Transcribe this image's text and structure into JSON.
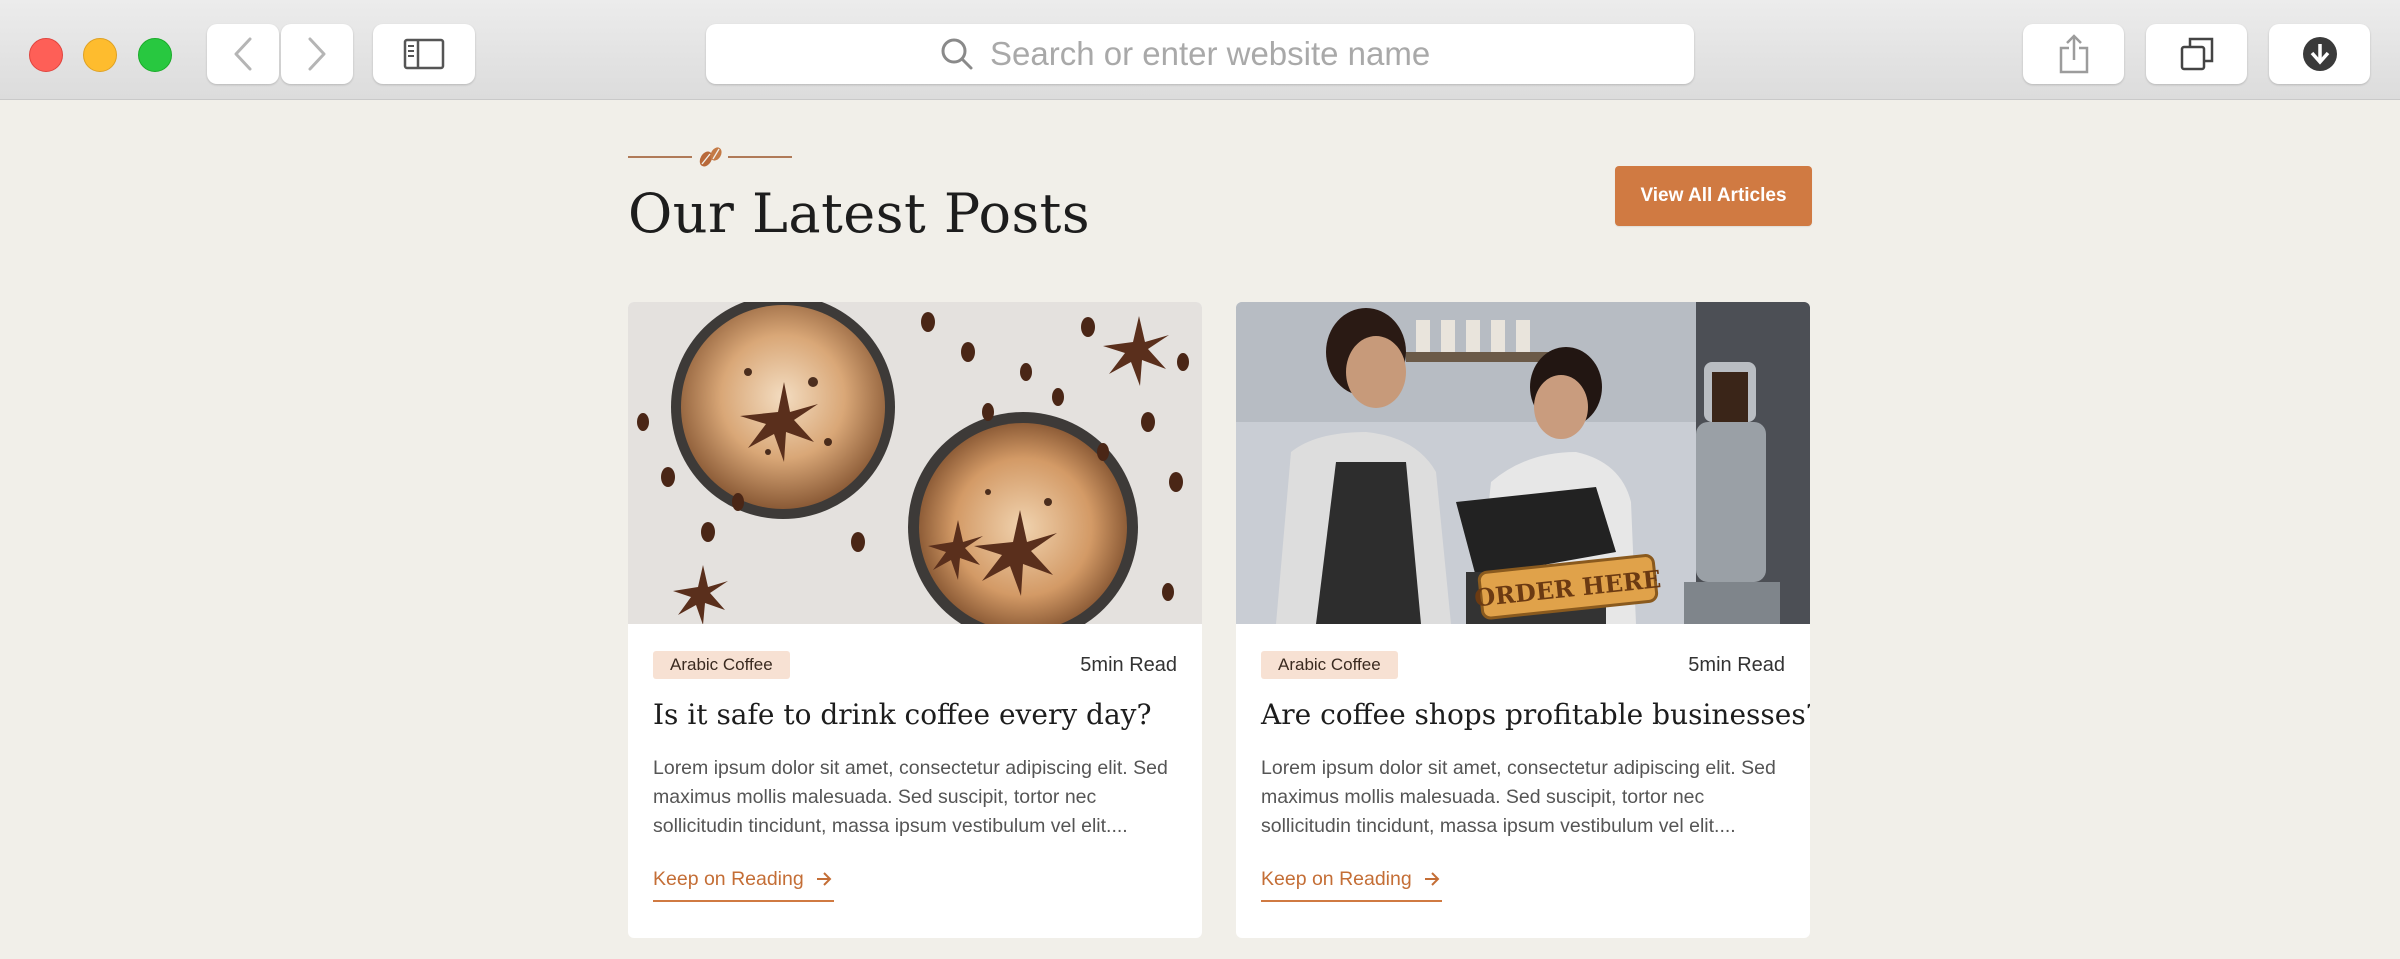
{
  "browser": {
    "address_placeholder": "Search or enter website name",
    "icons": [
      "back-icon",
      "forward-icon",
      "sidebar-icon",
      "search-icon",
      "share-icon",
      "tabs-icon",
      "download-icon"
    ]
  },
  "section": {
    "title": "Our Latest Posts",
    "view_all_label": "View All Articles"
  },
  "posts": [
    {
      "category": "Arabic Coffee",
      "read_time": "5min Read",
      "title": "Is it safe to drink coffee every day?",
      "excerpt": "Lorem ipsum dolor sit amet, consectetur adipiscing elit. Sed maximus mollis malesuada. Sed suscipit, tortor nec sollicitudin tincidunt, massa ipsum vestibulum vel elit....",
      "link_label": "Keep on Reading"
    },
    {
      "category": "Arabic Coffee",
      "read_time": "5min Read",
      "title": "Are coffee shops profitable businesses?",
      "excerpt": "Lorem ipsum dolor sit amet, consectetur adipiscing elit. Sed maximus mollis malesuada. Sed suscipit, tortor nec sollicitudin tincidunt, massa ipsum vestibulum vel elit....",
      "link_label": "Keep on Reading",
      "image_sign_text": "ORDER HERE"
    }
  ],
  "colors": {
    "accent": "#d07a42",
    "page_background": "#f1efe9",
    "badge_background": "#f7e1d3"
  }
}
